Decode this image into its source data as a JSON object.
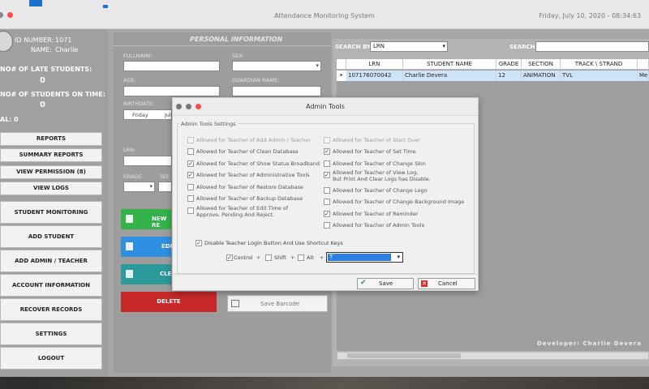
{
  "window": {
    "title": "Attendance Monitoring System",
    "datetime": "Friday, July  10, 2020 - 08:34:63"
  },
  "user": {
    "id_label": "ID NUMBER:",
    "id_value": "1071",
    "name_label": "NAME:",
    "name_value": "Charlie"
  },
  "stats": {
    "late_label": "NO# OF LATE STUDENTS:",
    "late_value": "0",
    "ontime_label": "NO# OF STUDENTS ON TIME:",
    "ontime_value": "0",
    "total_label": "AL:",
    "total_value": "0"
  },
  "sidebar": {
    "small_buttons": [
      "REPORTS",
      "SUMMARY REPORTS",
      "VIEW PERMISSION (8)",
      "VIEW LOGS"
    ],
    "large_buttons": [
      "STUDENT MONITORING",
      "ADD STUDENT",
      "ADD ADMIN / TEACHER",
      "ACCOUNT INFORMATION",
      "RECOVER RECORDS",
      "SETTINGS",
      "LOGOUT"
    ]
  },
  "personal": {
    "header": "PERSONAL INFORMATION",
    "fullname": "FULLNAME:",
    "sex": "SEX:",
    "age": "AGE:",
    "guardian": "GUARDIAN NAME:",
    "birthdate": "BIRTHDATE:",
    "birth_day": "Friday",
    "birth_month": "July",
    "lrn": "LRN:",
    "grade": "GRADE:",
    "section": "SEC",
    "new_record": "NEW RE",
    "edit": "EDI",
    "clear": "CLE",
    "delete": "DELETE",
    "save_barcode": "Save Barcode"
  },
  "right": {
    "search_by_label": "SEARCH BY:",
    "search_by_value": "LRN",
    "search_label": "SEARCH:",
    "columns": [
      "LRN",
      "STUDENT NAME",
      "GRADE",
      "SECTION",
      "TRACK \\ STRAND",
      ""
    ],
    "rows": [
      [
        "107176070042",
        "Charlie Devera",
        "12",
        "ANIMATION",
        "TVL",
        "Melo"
      ]
    ],
    "developer": "Developer: Charlie Devera"
  },
  "dialog": {
    "title": "Admin Tools",
    "group": "Admin Tools Settings",
    "left_options": [
      {
        "label": "Allowed for Teacher of Add Admin / Teacher",
        "checked": false,
        "disabled": true
      },
      {
        "label": "Allowed for Teacher of Clean Database",
        "checked": false,
        "disabled": false
      },
      {
        "label": "Allowed for Teacher of Show Status Broadband",
        "checked": true,
        "disabled": false
      },
      {
        "label": "Allowed for Teacher of Administrative Tools",
        "checked": true,
        "disabled": false
      },
      {
        "label": "Allowed for Teacher of Restore Database",
        "checked": false,
        "disabled": false
      },
      {
        "label": "Allowed for Teacher of Backup Database",
        "checked": false,
        "disabled": false
      },
      {
        "label": "Allowed for Teacher of Edit Time of",
        "label2": "Approve, Pending And Reject.",
        "checked": false,
        "disabled": false
      }
    ],
    "right_options": [
      {
        "label": "Allowed for Teacher of Start Over",
        "checked": false,
        "disabled": true
      },
      {
        "label": "Allowed for Teacher of Set Time",
        "checked": true,
        "disabled": false
      },
      {
        "label": "Allowed for Teacher of Change Skin",
        "checked": false,
        "disabled": false
      },
      {
        "label": "Allowed for Teacher of View Log,",
        "label2": "But Print And Clear Logs has Disable.",
        "checked": true,
        "disabled": false
      },
      {
        "label": "Allowed for Teacher of Change Logo",
        "checked": false,
        "disabled": false
      },
      {
        "label": "Allowed for Teacher of Change Background Image",
        "checked": false,
        "disabled": false
      },
      {
        "label": "Allowed for Teacher of Reminder",
        "checked": true,
        "disabled": false
      },
      {
        "label": "Allowed for Teacher of Admin Tools",
        "checked": false,
        "disabled": false
      }
    ],
    "disable_login": "Disable Teacher Login Button And Use Shortcut Keys",
    "ctrl": "Control",
    "shift": "Shift",
    "alt": "Alt",
    "plus": "+",
    "key_value": "T",
    "save": "Save",
    "cancel": "Cancel"
  },
  "colors": {
    "accent_red": "#ff4a4a",
    "green": "#33b24a",
    "blue": "#2f8fe0",
    "teal": "#2a9a9a",
    "delete_red": "#c62828"
  }
}
